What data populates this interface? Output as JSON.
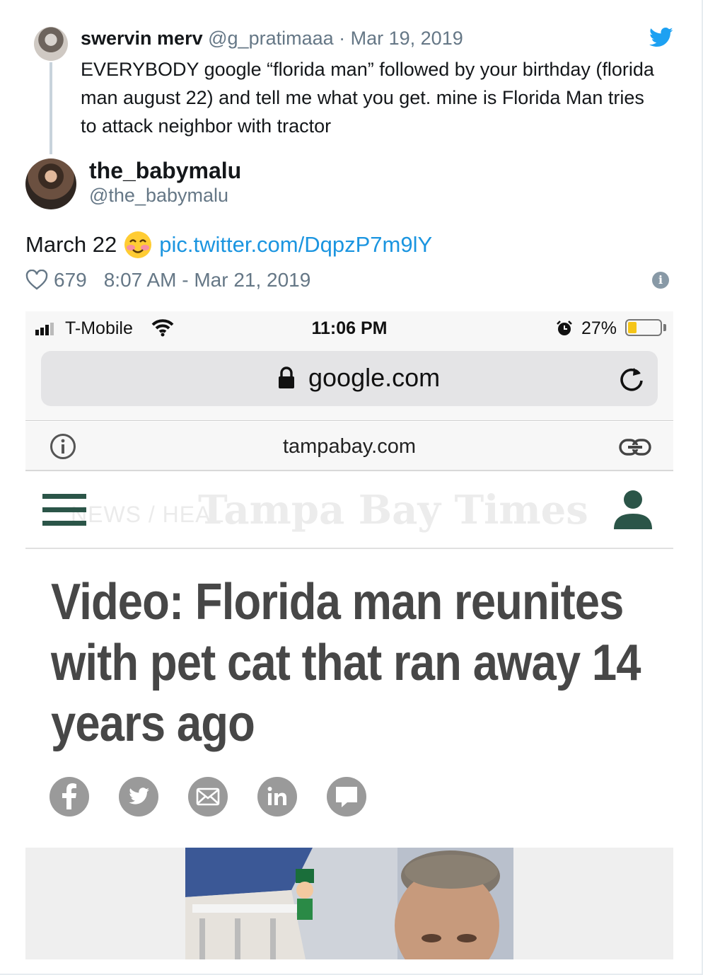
{
  "parent_tweet": {
    "name": "swervin merv",
    "meta": "@g_pratimaaa · Mar 19, 2019",
    "text": "EVERYBODY google “florida man” followed by your birthday (florida man august 22) and tell me what you get. mine is Florida Man tries to attack neighbor with tractor"
  },
  "reply_tweet": {
    "name": "the_babymalu",
    "handle": "@the_babymalu",
    "text": "March 22",
    "link": "pic.twitter.com/DqpzP7m9lY",
    "likes": "679",
    "timestamp": "8:07 AM - Mar 21, 2019"
  },
  "phone": {
    "carrier": "T-Mobile",
    "time": "11:06 PM",
    "battery_percent": "27%",
    "battery_level": 0.27,
    "address": "google.com",
    "site_domain": "tampabay.com",
    "breadcrumb": "NEWS / HEAL",
    "masthead": "Tampa Bay Times",
    "headline": "Video: Florida man reunites with pet cat that ran away 14 years ago",
    "share_buttons": [
      "facebook-icon",
      "twitter-icon",
      "email-icon",
      "linkedin-icon",
      "comment-icon"
    ]
  },
  "colors": {
    "link": "#1b95e0",
    "twitter_blue": "#1da1f2",
    "muted": "#657786",
    "tbt_green": "#2b5548",
    "headline": "#474747"
  }
}
